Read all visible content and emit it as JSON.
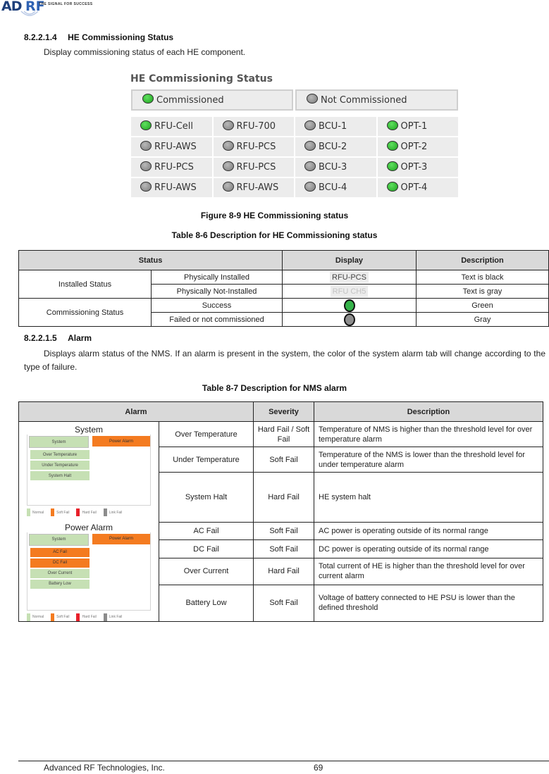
{
  "header": {
    "logo_text_ad": "AD",
    "logo_text_rf": "RF",
    "tagline": "THE SIGNAL FOR SUCCESS"
  },
  "section_1": {
    "number": "8.2.2.1.4",
    "title": "HE Commissioning Status",
    "body": "Display commissioning status of each HE component."
  },
  "he_screenshot": {
    "title": "HE Commissioning Status",
    "legend": [
      {
        "state": "green",
        "label": "Commissioned"
      },
      {
        "state": "gray",
        "label": "Not Commissioned"
      }
    ],
    "components": [
      {
        "label": "RFU-Cell",
        "state": "green"
      },
      {
        "label": "RFU-700",
        "state": "gray"
      },
      {
        "label": "BCU-1",
        "state": "gray"
      },
      {
        "label": "OPT-1",
        "state": "green"
      },
      {
        "label": "RFU-AWS",
        "state": "gray"
      },
      {
        "label": "RFU-PCS",
        "state": "gray"
      },
      {
        "label": "BCU-2",
        "state": "gray"
      },
      {
        "label": "OPT-2",
        "state": "green"
      },
      {
        "label": "RFU-PCS",
        "state": "gray"
      },
      {
        "label": "RFU-PCS",
        "state": "gray"
      },
      {
        "label": "BCU-3",
        "state": "gray"
      },
      {
        "label": "OPT-3",
        "state": "green"
      },
      {
        "label": "RFU-AWS",
        "state": "gray"
      },
      {
        "label": "RFU-AWS",
        "state": "gray"
      },
      {
        "label": "BCU-4",
        "state": "gray"
      },
      {
        "label": "OPT-4",
        "state": "green"
      }
    ],
    "colors": {
      "green": "#2ea82e",
      "gray": "#8a8a8a"
    }
  },
  "figure_caption": "Figure 8-9      HE Commissioning status",
  "table_1": {
    "caption": "Table 8-6       Description for HE Commissioning status",
    "headers": [
      "Status",
      "Display",
      "Description"
    ],
    "groups": [
      {
        "name": "Installed Status",
        "rows": [
          {
            "status": "Physically Installed",
            "display_text": "RFU-PCS",
            "description": "Text is black"
          },
          {
            "status": "Physically Not-Installed",
            "display_text": "RFU CH5",
            "description": "Text is gray"
          }
        ]
      },
      {
        "name": "Commissioning  Status",
        "rows": [
          {
            "status": "Success",
            "display_icon": "green-led",
            "description": "Green"
          },
          {
            "status": "Failed or not commissioned",
            "display_icon": "gray-led",
            "description": "Gray"
          }
        ]
      }
    ]
  },
  "section_2": {
    "number": "8.2.2.1.5",
    "title": "Alarm",
    "body": "Displays alarm status of the NMS. If an alarm is present in the system, the color of the system alarm tab will change according to the type of failure."
  },
  "table_2": {
    "caption": "Table 8-7       Description for NMS alarm",
    "headers": [
      "Alarm",
      "Severity",
      "Description"
    ],
    "groups": [
      {
        "name": "System",
        "mini": {
          "tabs": [
            "System",
            "Power Alarm"
          ],
          "items": [
            {
              "label": "Over Temperature",
              "color": "green"
            },
            {
              "label": "Under Temperature",
              "color": "green"
            },
            {
              "label": "System Halt",
              "color": "green"
            }
          ]
        },
        "rows": [
          {
            "alarm": "Over Temperature",
            "severity": "Hard Fail / Soft Fail",
            "description": "Temperature of NMS is higher than the threshold level for over temperature alarm"
          },
          {
            "alarm": "Under Temperature",
            "severity": "Soft Fail",
            "description": "Temperature of the NMS is lower than the threshold level for under temperature alarm"
          },
          {
            "alarm": "System Halt",
            "severity": "Hard Fail",
            "description": "HE system halt"
          }
        ]
      },
      {
        "name": "Power Alarm",
        "mini": {
          "tabs": [
            "System",
            "Power Alarm"
          ],
          "items": [
            {
              "label": "AC Fail",
              "color": "orange"
            },
            {
              "label": "DC Fail",
              "color": "orange"
            },
            {
              "label": "Over Current",
              "color": "green"
            },
            {
              "label": "Battery Low",
              "color": "green"
            }
          ]
        },
        "rows": [
          {
            "alarm": "AC Fail",
            "severity": "Soft Fail",
            "description": "AC power is operating outside of its normal range"
          },
          {
            "alarm": "DC Fail",
            "severity": "Soft Fail",
            "description": "DC power is operating outside of its normal range"
          },
          {
            "alarm": "Over Current",
            "severity": "Hard Fail",
            "description": "Total current of HE is higher than the threshold level for over current alarm"
          },
          {
            "alarm": "Battery Low",
            "severity": "Soft Fail",
            "description": "Voltage of battery connected to HE PSU is lower than the defined threshold"
          }
        ]
      }
    ],
    "legend": [
      {
        "label": "Normal",
        "color": "#c6e0b4"
      },
      {
        "label": "Soft Fail",
        "color": "#f47b20"
      },
      {
        "label": "Hard Fail",
        "color": "#e8202a"
      },
      {
        "label": "Link Fail",
        "color": "#8c8c8c"
      }
    ]
  },
  "footer": {
    "company": "Advanced RF Technologies, Inc.",
    "page": "69"
  }
}
